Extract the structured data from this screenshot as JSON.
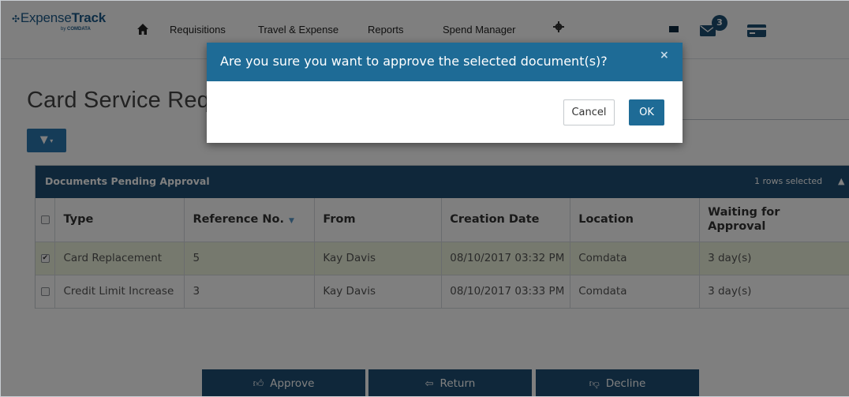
{
  "app": {
    "logo_prefix": "Expense",
    "logo_bold": "Track",
    "logo_by": "by",
    "logo_company": "COMDATA"
  },
  "nav": {
    "items": [
      "Requisitions",
      "Travel & Expense",
      "Reports",
      "Spend Manager"
    ],
    "mail_count": "3"
  },
  "page": {
    "title": "Card Service Requests"
  },
  "panel": {
    "title": "Documents Pending Approval",
    "rows_selected": "1 rows selected"
  },
  "table": {
    "headers": {
      "type": "Type",
      "reference": "Reference No.",
      "from": "From",
      "creation_date": "Creation Date",
      "location": "Location",
      "waiting_line1": "Waiting for",
      "waiting_line2": "Approval"
    },
    "rows": [
      {
        "checked": true,
        "type": "Card Replacement",
        "reference": "5",
        "from": "Kay Davis",
        "creation_date": "08/10/2017 03:32 PM",
        "location": "Comdata",
        "waiting": "3 day(s)"
      },
      {
        "checked": false,
        "type": "Credit Limit Increase",
        "reference": "3",
        "from": "Kay Davis",
        "creation_date": "08/10/2017 03:33 PM",
        "location": "Comdata",
        "waiting": "3 day(s)"
      }
    ]
  },
  "actions": {
    "approve": "Approve",
    "return": "Return",
    "decline": "Decline"
  },
  "modal": {
    "title": "Are you sure you want to approve the selected document(s)?",
    "close": "×",
    "cancel": "Cancel",
    "ok": "OK"
  },
  "colors": {
    "header_bar": "#1e4e74",
    "modal_header": "#1e6b96",
    "selected_row": "#edf3dc",
    "action_button": "#1e4e74",
    "link": "#2a78b0"
  }
}
